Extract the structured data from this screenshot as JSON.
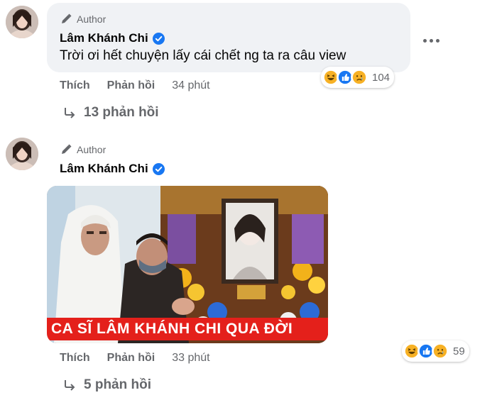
{
  "comments": [
    {
      "author_badge": "Author",
      "name": "Lâm Khánh Chi",
      "text": "Trời ơi hết chuyện lấy cái chết ng ta ra câu view",
      "like_label": "Thích",
      "reply_label": "Phản hồi",
      "time": "34 phút",
      "reaction_count": "104",
      "replies_label": "13 phản hồi"
    },
    {
      "author_badge": "Author",
      "name": "Lâm Khánh Chi",
      "image_banner": "CA SĨ LÂM KHÁNH CHI QUA ĐỜI",
      "like_label": "Thích",
      "reply_label": "Phản hồi",
      "time": "33 phút",
      "reaction_count": "59",
      "replies_label": "5 phản hồi"
    }
  ],
  "colors": {
    "bubble": "#f0f2f5",
    "verified": "#1877f2",
    "muted_text": "#65676b",
    "banner": "#e4201b",
    "haha": "#f7b125",
    "like": "#1877f2"
  },
  "icons": [
    "author-pencil-icon",
    "verified-icon",
    "more-options-icon",
    "reply-arrow-icon",
    "haha-reaction-icon",
    "like-reaction-icon",
    "sad-reaction-icon"
  ]
}
